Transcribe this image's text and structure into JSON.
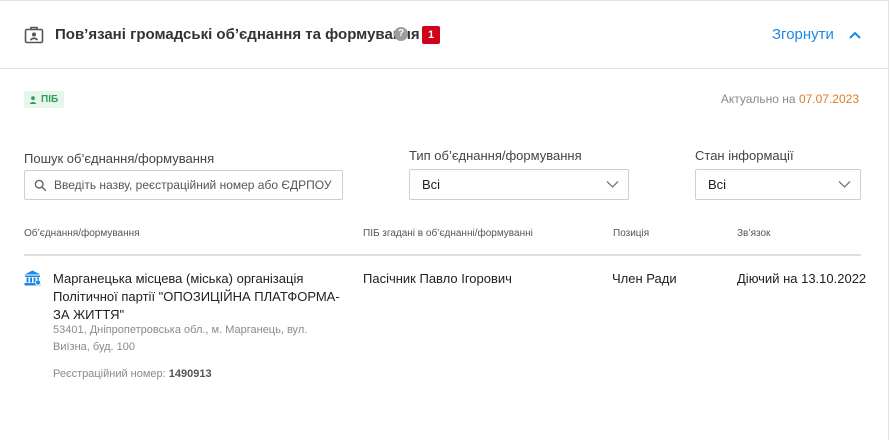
{
  "header": {
    "title": "Пов’язані громадські об’єднання та формування",
    "help_symbol": "?",
    "count": "1",
    "collapse_label": "Згорнути"
  },
  "tag": {
    "label": "ПІБ"
  },
  "actuality": {
    "prefix": "Актуально на",
    "date": "07.07.2023"
  },
  "filters": {
    "search": {
      "label": "Пошук об’єднання/формування",
      "placeholder": "Введіть назву, реєстраційний номер або ЄДРПОУ",
      "value": ""
    },
    "type": {
      "label": "Тип об’єднання/формування",
      "selected": "Всі"
    },
    "status": {
      "label": "Стан інформації",
      "selected": "Всі"
    }
  },
  "table": {
    "columns": [
      "Об’єднання/формування",
      "ПІБ згадані в об’єднанні/формуванні",
      "Позиція",
      "Зв’язок"
    ],
    "rows": [
      {
        "name": "Марганецька місцева (міська) організація Політичної партії \"ОПОЗИЦІЙНА ПЛАТФОРМА-ЗА ЖИТТЯ\"",
        "address": "53401, Дніпропетровська обл., м. Марганець, вул. Виїзна, буд. 100",
        "reg_label": "Реєстраційний номер:",
        "reg_number": "1490913",
        "person": "Пасічник Павло Ігорович",
        "position": "Член Ради",
        "relation": "Діючий на 13.10.2022"
      }
    ]
  },
  "colors": {
    "accent": "#1e88e5",
    "badge": "#d0021b",
    "tag_bg": "#e7f6ec",
    "tag_text": "#2e9d5a",
    "date_orange": "#e07b26",
    "org_icon": "#1e88e5"
  },
  "icons": {
    "header": "briefcase-id-icon",
    "help": "help-icon",
    "collapse": "chevron-up-icon",
    "tag": "person-icon",
    "search": "search-icon",
    "select": "chevron-down-icon",
    "org": "institution-icon"
  }
}
